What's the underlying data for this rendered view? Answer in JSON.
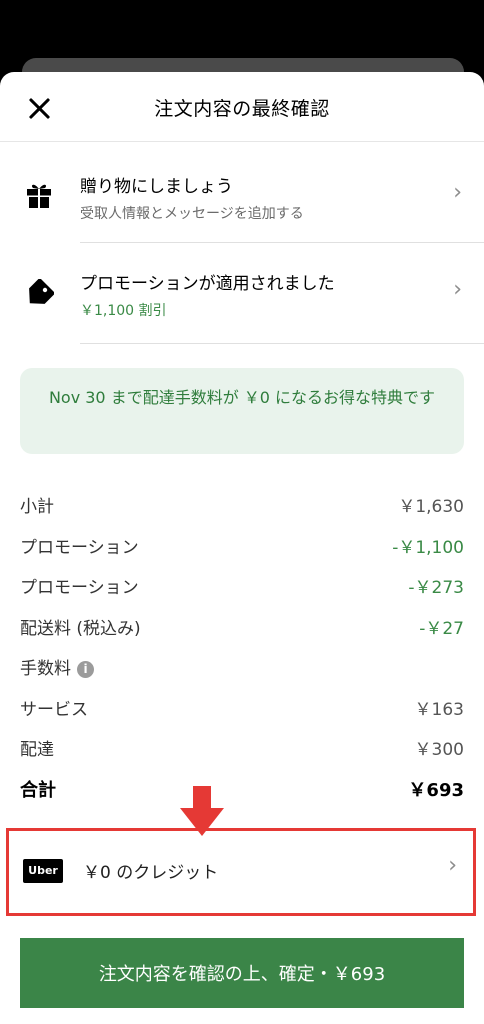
{
  "header": {
    "title": "注文内容の最終確認"
  },
  "gift": {
    "title": "贈り物にしましょう",
    "subtitle": "受取人情報とメッセージを追加する",
    "chevron": "›"
  },
  "promotion": {
    "title": "プロモーションが適用されました",
    "subtitle": "￥1,100 割引",
    "chevron": "›"
  },
  "banner": {
    "text": "Nov 30 まで配達手数料が ￥0 になるお得な特典です"
  },
  "summary": {
    "subtotal": {
      "label": "小計",
      "amount": "￥1,630"
    },
    "promo1": {
      "label": "プロモーション",
      "amount": "-￥1,100"
    },
    "promo2": {
      "label": "プロモーション",
      "amount": "-￥273"
    },
    "shipping": {
      "label": "配送料 (税込み)",
      "amount": "-￥27"
    },
    "fees": {
      "label": "手数料",
      "info": "i"
    },
    "service": {
      "label": "サービス",
      "amount": "￥163"
    },
    "delivery": {
      "label": "配達",
      "amount": "￥300"
    },
    "total": {
      "label": "合計",
      "amount": "￥693"
    }
  },
  "credit": {
    "logo": "Uber",
    "text": "￥0 のクレジット",
    "chevron": "›"
  },
  "confirm": {
    "label": "注文内容を確認の上、確定・￥693"
  },
  "colors": {
    "accent_green": "#3b8548",
    "highlight_red": "#e53935",
    "banner_bg": "#e9f3ec"
  },
  "icons": [
    "close-icon",
    "gift-icon",
    "tag-icon",
    "chevron-right-icon",
    "info-icon",
    "down-arrow-icon",
    "uber-logo"
  ]
}
